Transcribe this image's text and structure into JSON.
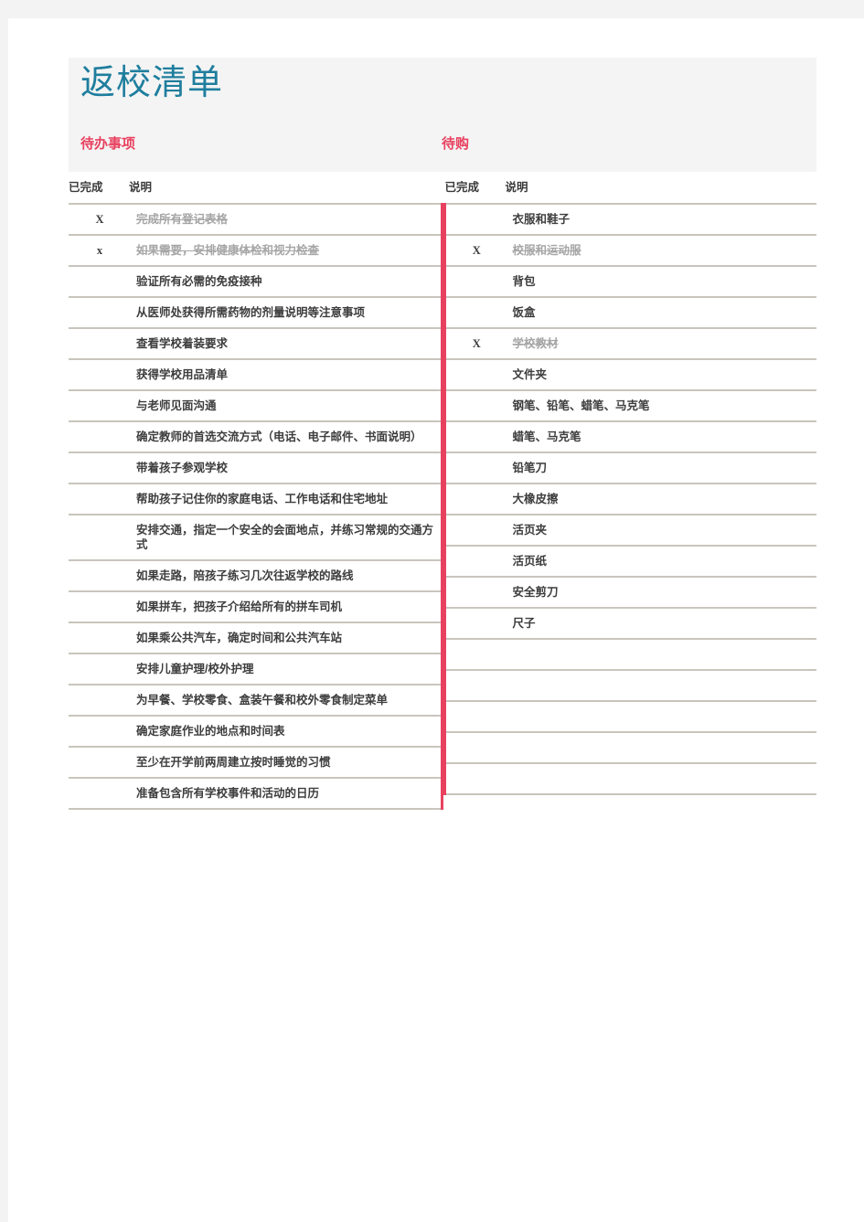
{
  "document": {
    "title": "返校清单",
    "title_color": "#1f7e9e",
    "accent_color": "#e8415f",
    "mark_color": "#c0392b",
    "band_color": "#f4f4f4",
    "rule_color": "#c9c5bd"
  },
  "sections": {
    "todo": {
      "heading": "待办事项",
      "columns": [
        "已完成",
        "说明"
      ],
      "rows": [
        {
          "done": "X",
          "desc": "完成所有登记表格",
          "completed": true
        },
        {
          "done": "x",
          "desc": "如果需要，安排健康体检和视力检查",
          "completed": true
        },
        {
          "done": "",
          "desc": "验证所有必需的免疫接种",
          "completed": false
        },
        {
          "done": "",
          "desc": "从医师处获得所需药物的剂量说明等注意事项",
          "completed": false
        },
        {
          "done": "",
          "desc": "查看学校着装要求",
          "completed": false
        },
        {
          "done": "",
          "desc": "获得学校用品清单",
          "completed": false
        },
        {
          "done": "",
          "desc": "与老师见面沟通",
          "completed": false
        },
        {
          "done": "",
          "desc": "确定教师的首选交流方式（电话、电子邮件、书面说明）",
          "completed": false
        },
        {
          "done": "",
          "desc": "带着孩子参观学校",
          "completed": false
        },
        {
          "done": "",
          "desc": "帮助孩子记住你的家庭电话、工作电话和住宅地址",
          "completed": false
        },
        {
          "done": "",
          "desc": "安排交通，指定一个安全的会面地点，并练习常规的交通方式",
          "completed": false
        },
        {
          "done": "",
          "desc": "如果走路，陪孩子练习几次往返学校的路线",
          "completed": false
        },
        {
          "done": "",
          "desc": "如果拼车，把孩子介绍给所有的拼车司机",
          "completed": false
        },
        {
          "done": "",
          "desc": "如果乘公共汽车，确定时间和公共汽车站",
          "completed": false
        },
        {
          "done": "",
          "desc": "安排儿童护理/校外护理",
          "completed": false
        },
        {
          "done": "",
          "desc": "为早餐、学校零食、盒装午餐和校外零食制定菜单",
          "completed": false
        },
        {
          "done": "",
          "desc": "确定家庭作业的地点和时间表",
          "completed": false
        },
        {
          "done": "",
          "desc": "至少在开学前两周建立按时睡觉的习惯",
          "completed": false
        },
        {
          "done": "",
          "desc": "准备包含所有学校事件和活动的日历",
          "completed": false
        }
      ]
    },
    "buy": {
      "heading": "待购",
      "columns": [
        "已完成",
        "说明"
      ],
      "rows": [
        {
          "done": "",
          "desc": "衣服和鞋子",
          "completed": false
        },
        {
          "done": "X",
          "desc": "校服和运动服",
          "completed": true
        },
        {
          "done": "",
          "desc": "背包",
          "completed": false
        },
        {
          "done": "",
          "desc": "饭盒",
          "completed": false
        },
        {
          "done": "X",
          "desc": "学校教材",
          "completed": true
        },
        {
          "done": "",
          "desc": "文件夹",
          "completed": false
        },
        {
          "done": "",
          "desc": "钢笔、铅笔、蜡笔、马克笔",
          "completed": false
        },
        {
          "done": "",
          "desc": "蜡笔、马克笔",
          "completed": false
        },
        {
          "done": "",
          "desc": "铅笔刀",
          "completed": false
        },
        {
          "done": "",
          "desc": "大橡皮擦",
          "completed": false
        },
        {
          "done": "",
          "desc": "活页夹",
          "completed": false
        },
        {
          "done": "",
          "desc": "活页纸",
          "completed": false
        },
        {
          "done": "",
          "desc": "安全剪刀",
          "completed": false
        },
        {
          "done": "",
          "desc": "尺子",
          "completed": false
        },
        {
          "done": "",
          "desc": "",
          "completed": false
        },
        {
          "done": "",
          "desc": "",
          "completed": false
        },
        {
          "done": "",
          "desc": "",
          "completed": false
        },
        {
          "done": "",
          "desc": "",
          "completed": false
        },
        {
          "done": "",
          "desc": "",
          "completed": false
        }
      ]
    }
  }
}
